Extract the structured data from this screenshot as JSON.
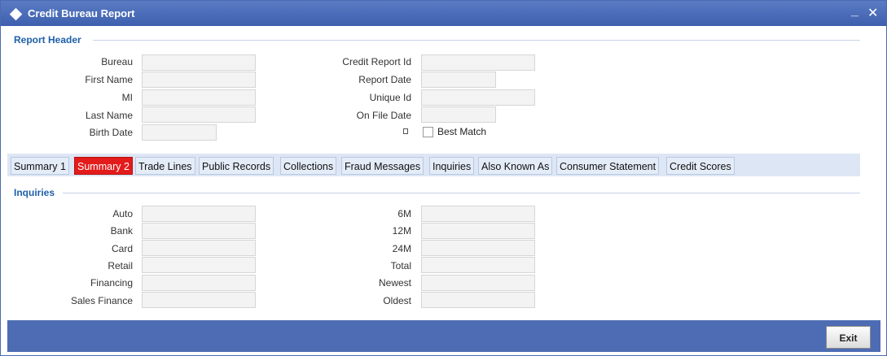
{
  "window": {
    "title": "Credit Bureau Report",
    "minimize": "_",
    "close": "✕"
  },
  "report_header": {
    "section_title": "Report Header",
    "left_fields": [
      {
        "label": "Bureau",
        "value": ""
      },
      {
        "label": "First Name",
        "value": ""
      },
      {
        "label": "MI",
        "value": ""
      },
      {
        "label": "Last Name",
        "value": ""
      },
      {
        "label": "Birth Date",
        "value": ""
      }
    ],
    "right_fields": [
      {
        "label": "Credit Report Id",
        "value": ""
      },
      {
        "label": "Report Date",
        "value": ""
      },
      {
        "label": "Unique Id",
        "value": ""
      },
      {
        "label": "On File Date",
        "value": ""
      }
    ],
    "best_match": {
      "label": "Best Match",
      "checked": false
    }
  },
  "tabs": [
    {
      "label": "Summary 1",
      "active": false
    },
    {
      "label": "Summary 2",
      "active": true
    },
    {
      "label": "Trade Lines",
      "active": false
    },
    {
      "label": "Public Records",
      "active": false
    },
    {
      "label": "Collections",
      "active": false
    },
    {
      "label": "Fraud Messages",
      "active": false
    },
    {
      "label": "Inquiries",
      "active": false
    },
    {
      "label": "Also Known As",
      "active": false
    },
    {
      "label": "Consumer Statement",
      "active": false
    },
    {
      "label": "Credit Scores",
      "active": false
    }
  ],
  "inquiries": {
    "section_title": "Inquiries",
    "left_fields": [
      {
        "label": "Auto",
        "value": ""
      },
      {
        "label": "Bank",
        "value": ""
      },
      {
        "label": "Card",
        "value": ""
      },
      {
        "label": "Retail",
        "value": ""
      },
      {
        "label": "Financing",
        "value": ""
      },
      {
        "label": "Sales Finance",
        "value": ""
      }
    ],
    "right_fields": [
      {
        "label": "6M",
        "value": ""
      },
      {
        "label": "12M",
        "value": ""
      },
      {
        "label": "24M",
        "value": ""
      },
      {
        "label": "Total",
        "value": ""
      },
      {
        "label": "Newest",
        "value": ""
      },
      {
        "label": "Oldest",
        "value": ""
      }
    ]
  },
  "footer": {
    "exit_label": "Exit"
  },
  "colors": {
    "titlebar": "#3e5fae",
    "section_title": "#1f5fa8",
    "active_tab": "#e31b1b",
    "footer": "#4d6cb3"
  }
}
